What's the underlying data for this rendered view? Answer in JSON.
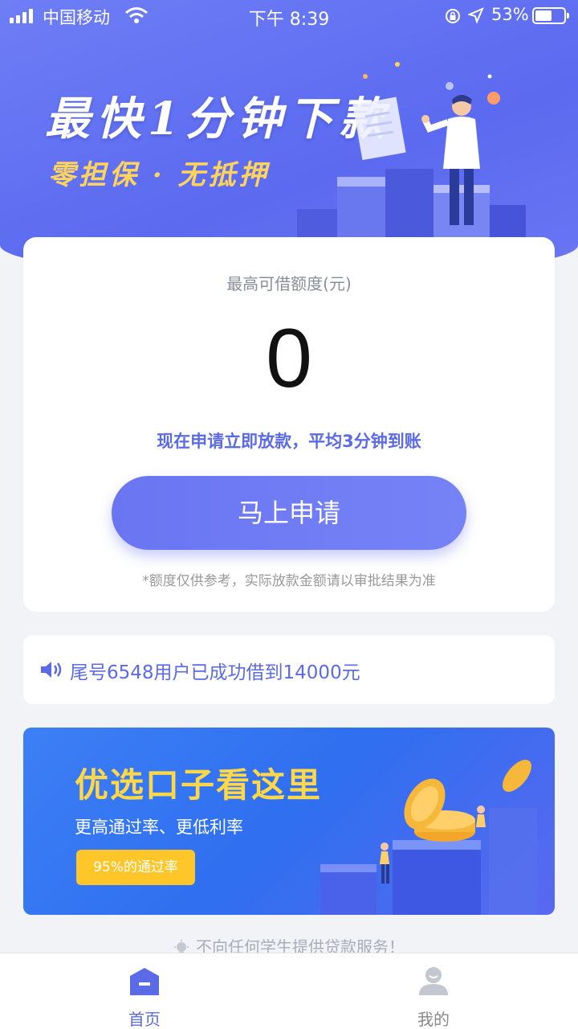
{
  "status_bar": {
    "carrier": "中国移动",
    "time": "下午 8:39",
    "battery_pct": "53%"
  },
  "hero": {
    "title": "最快1分钟下款",
    "subtitle": "零担保 · 无抵押"
  },
  "quota": {
    "label": "最高可借额度(元)",
    "value": "0",
    "tip": "现在申请立即放款，平均3分钟到账",
    "apply_label": "马上申请",
    "disclaimer": "*额度仅供参考，实际放款金额请以审批结果为准"
  },
  "notice": {
    "text": "尾号6548用户已成功借到14000元"
  },
  "promo": {
    "title": "优选口子看这里",
    "subtitle": "更高通过率、更低利率",
    "badge": "95%的通过率"
  },
  "footer_note": "不向任何学生提供贷款服务！",
  "tabbar": {
    "items": [
      {
        "label": "首页",
        "icon": "home-icon",
        "active": true
      },
      {
        "label": "我的",
        "icon": "user-icon",
        "active": false
      }
    ]
  },
  "colors": {
    "primary": "#5b6ae6",
    "hero_bg": "#6e7ef5",
    "accent_yellow": "#ffd45c",
    "badge_yellow": "#ffc62a"
  }
}
